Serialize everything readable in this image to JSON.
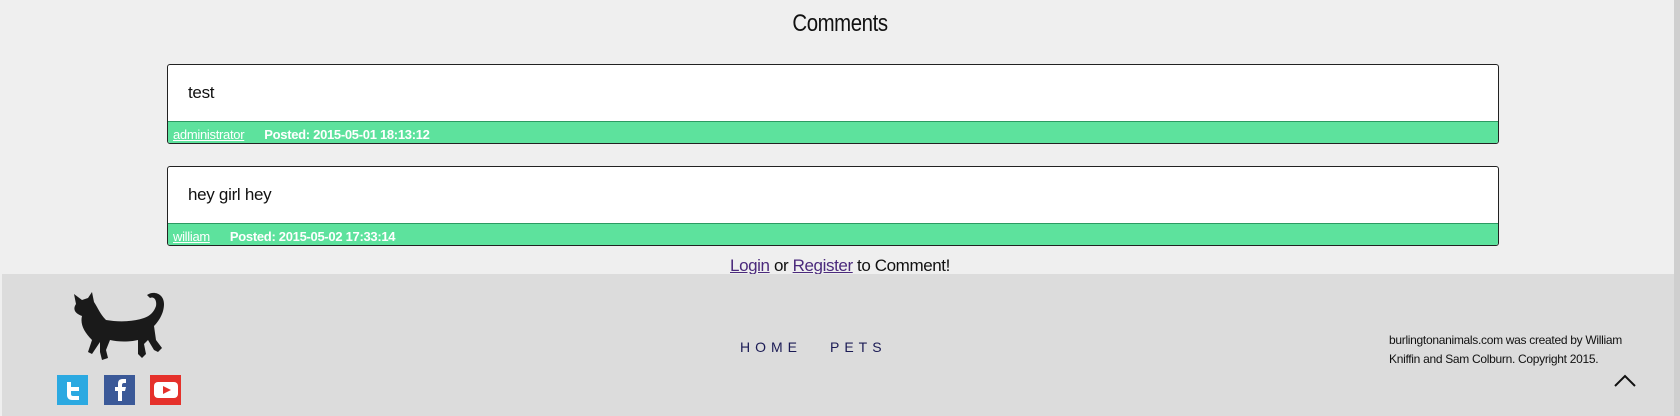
{
  "comments": {
    "title": "Comments",
    "items": [
      {
        "text": "test",
        "author": "administrator",
        "posted": "Posted: 2015-05-01 18:13:12"
      },
      {
        "text": "hey girl hey",
        "author": "william",
        "posted": "Posted: 2015-05-02 17:33:14"
      }
    ],
    "login_link": "Login",
    "or_text": "or",
    "register_link": "Register",
    "to_comment_text": "to Comment!"
  },
  "footer": {
    "logo_icon": "black-cat-icon",
    "social": [
      {
        "name": "twitter-icon",
        "color": "#2ba9e1"
      },
      {
        "name": "facebook-icon",
        "color": "#3b5998"
      },
      {
        "name": "youtube-icon",
        "color": "#e5312b"
      }
    ],
    "nav": [
      "HOME",
      "PETS"
    ],
    "credits": "burlingtonanimals.com was created by William Kniffin and Sam Colburn. Copyright 2015.",
    "back_to_top_icon": "chevron-up-icon"
  },
  "colors": {
    "page_bg": "#efefef",
    "footer_bg": "#dcdcdc",
    "meta_bar": "#5de29d",
    "nav_text": "#1b1b55",
    "link_visited": "#4b2a7c"
  }
}
